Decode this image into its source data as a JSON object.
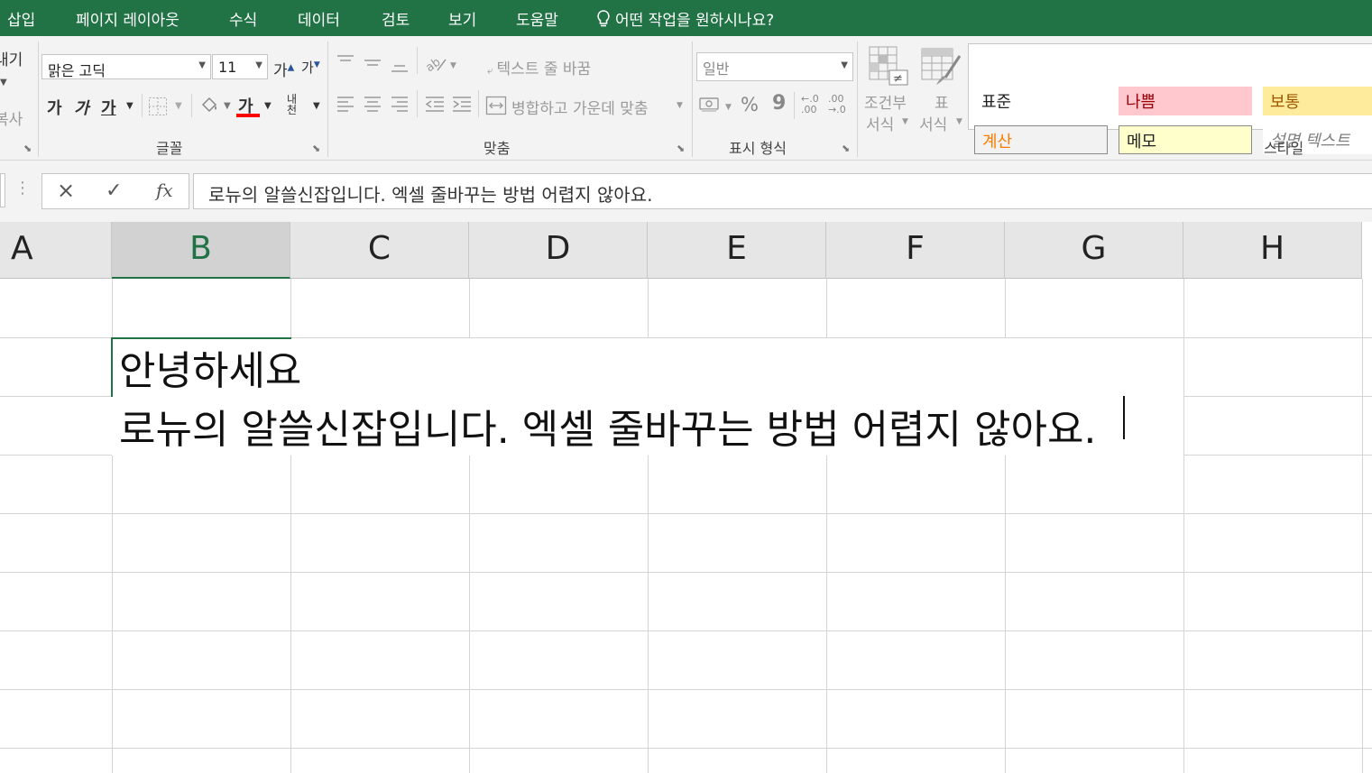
{
  "menu": {
    "tabs": [
      "삽입",
      "페이지 레이아웃",
      "수식",
      "데이터",
      "검토",
      "보기",
      "도움말"
    ],
    "tell_me": "어떤 작업을 원하시나요?"
  },
  "ribbon": {
    "clipboard": {
      "paste_fragment": "내기",
      "copy_fragment": "복사"
    },
    "font": {
      "font_name": "맑은 고딕",
      "font_size": "11",
      "grow_label": "가",
      "shrink_label": "가",
      "bold_label": "가",
      "italic_label": "가",
      "underline_label": "가",
      "font_color_label": "가",
      "phonetic_label": "내천",
      "group_label": "글꼴"
    },
    "alignment": {
      "wrap_text": "텍스트 줄 바꿈",
      "merge_center": "병합하고 가운데 맞춤",
      "group_label": "맞춤"
    },
    "number": {
      "format": "일반",
      "percent": "%",
      "comma": "9",
      "inc_decimal": "←.0 .00",
      "dec_decimal": ".00 →.0",
      "group_label": "표시 형식"
    },
    "styles": {
      "conditional_formatting": [
        "조건부",
        "서식"
      ],
      "format_as_table": [
        "표",
        "서식"
      ],
      "cells": [
        {
          "label": "표준",
          "bg": "#ffffff",
          "fg": "#222222"
        },
        {
          "label": "나쁨",
          "bg": "#ffc7ce",
          "fg": "#9c0006"
        },
        {
          "label": "보통",
          "bg": "#ffeb9c",
          "fg": "#9c5700"
        },
        {
          "label": "계산",
          "bg": "#f2f2f2",
          "fg": "#fa7d00"
        },
        {
          "label": "메모",
          "bg": "#ffffcc",
          "fg": "#222222"
        },
        {
          "label": "설명 텍스트",
          "bg": "#ffffff",
          "fg": "#7f7f7f"
        }
      ],
      "group_label": "스타일"
    }
  },
  "formula_bar": {
    "cancel_icon": "×",
    "enter_icon": "✓",
    "fx_label": "fx",
    "content": "로뉴의 알쓸신잡입니다. 엑셀 줄바꾸는 방법 어렵지 않아요."
  },
  "columns": [
    "A",
    "B",
    "C",
    "D",
    "E",
    "F",
    "G",
    "H"
  ],
  "active_column": "B",
  "cell_b2": {
    "line1": "안녕하세요",
    "line2": "로뉴의 알쓸신잡입니다. 엑셀 줄바꾸는 방법 어렵지 않아요."
  },
  "colors": {
    "accent": "#217346",
    "font_color_bar": "#ff0000"
  }
}
